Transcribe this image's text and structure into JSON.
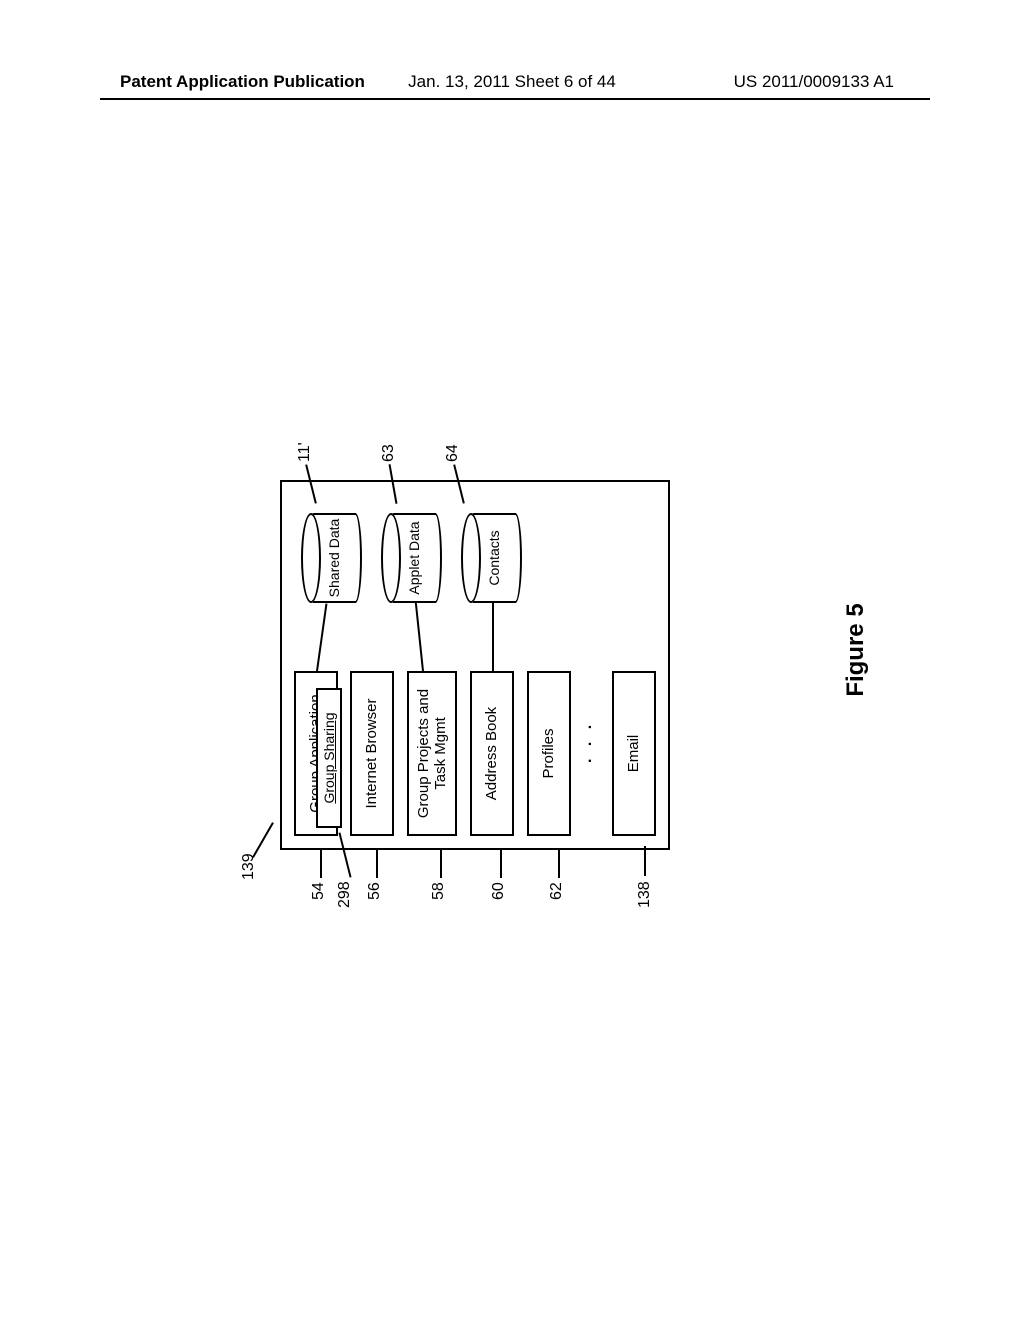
{
  "header": {
    "left": "Patent Application Publication",
    "center": "Jan. 13, 2011  Sheet 6 of 44",
    "right": "US 2011/0009133 A1"
  },
  "refs": {
    "r139": "139",
    "r54": "54",
    "r298": "298",
    "r56": "56",
    "r58": "58",
    "r60": "60",
    "r62": "62",
    "r138": "138",
    "r11": "11'",
    "r63": "63",
    "r64": "64"
  },
  "boxes": {
    "group": "Group Application",
    "group_inner": "Group Sharing",
    "browser": "Internet Browser",
    "projects": "Group Projects and Task Mgmt",
    "address": "Address Book",
    "profiles": "Profiles",
    "email": "Email",
    "dots": ". . ."
  },
  "cyls": {
    "shared": "Shared Data",
    "applet": "Applet Data",
    "contacts": "Contacts"
  },
  "caption": "Figure 5"
}
